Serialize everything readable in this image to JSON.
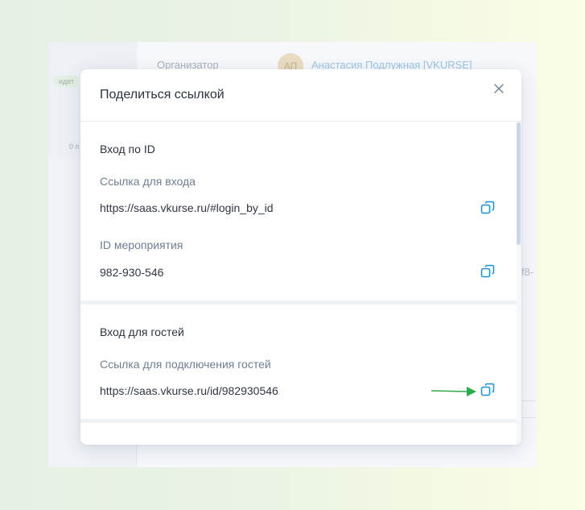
{
  "background": {
    "sidebar_badge": "идет",
    "sidebar_count": "0 п",
    "organizer_label": "Организатор",
    "avatar_initials": "АП",
    "organizer_name": "Анастасия Подлужная [VKURSE]",
    "partial_text": "f8-"
  },
  "modal": {
    "title": "Поделиться ссылкой",
    "close_icon": "close-icon",
    "sections": [
      {
        "title": "Вход по ID",
        "fields": [
          {
            "label": "Ссылка для входа",
            "value": "https://saas.vkurse.ru/#login_by_id"
          },
          {
            "label": "ID мероприятия",
            "value": "982-930-546"
          }
        ]
      },
      {
        "title": "Вход для гостей",
        "fields": [
          {
            "label": "Ссылка для подключения гостей",
            "value": "https://saas.vkurse.ru/id/982930546"
          }
        ]
      }
    ]
  },
  "colors": {
    "accent": "#1b8fd6",
    "arrow": "#2eaa4a",
    "title": "#2a3340",
    "label": "#6e7e93"
  }
}
